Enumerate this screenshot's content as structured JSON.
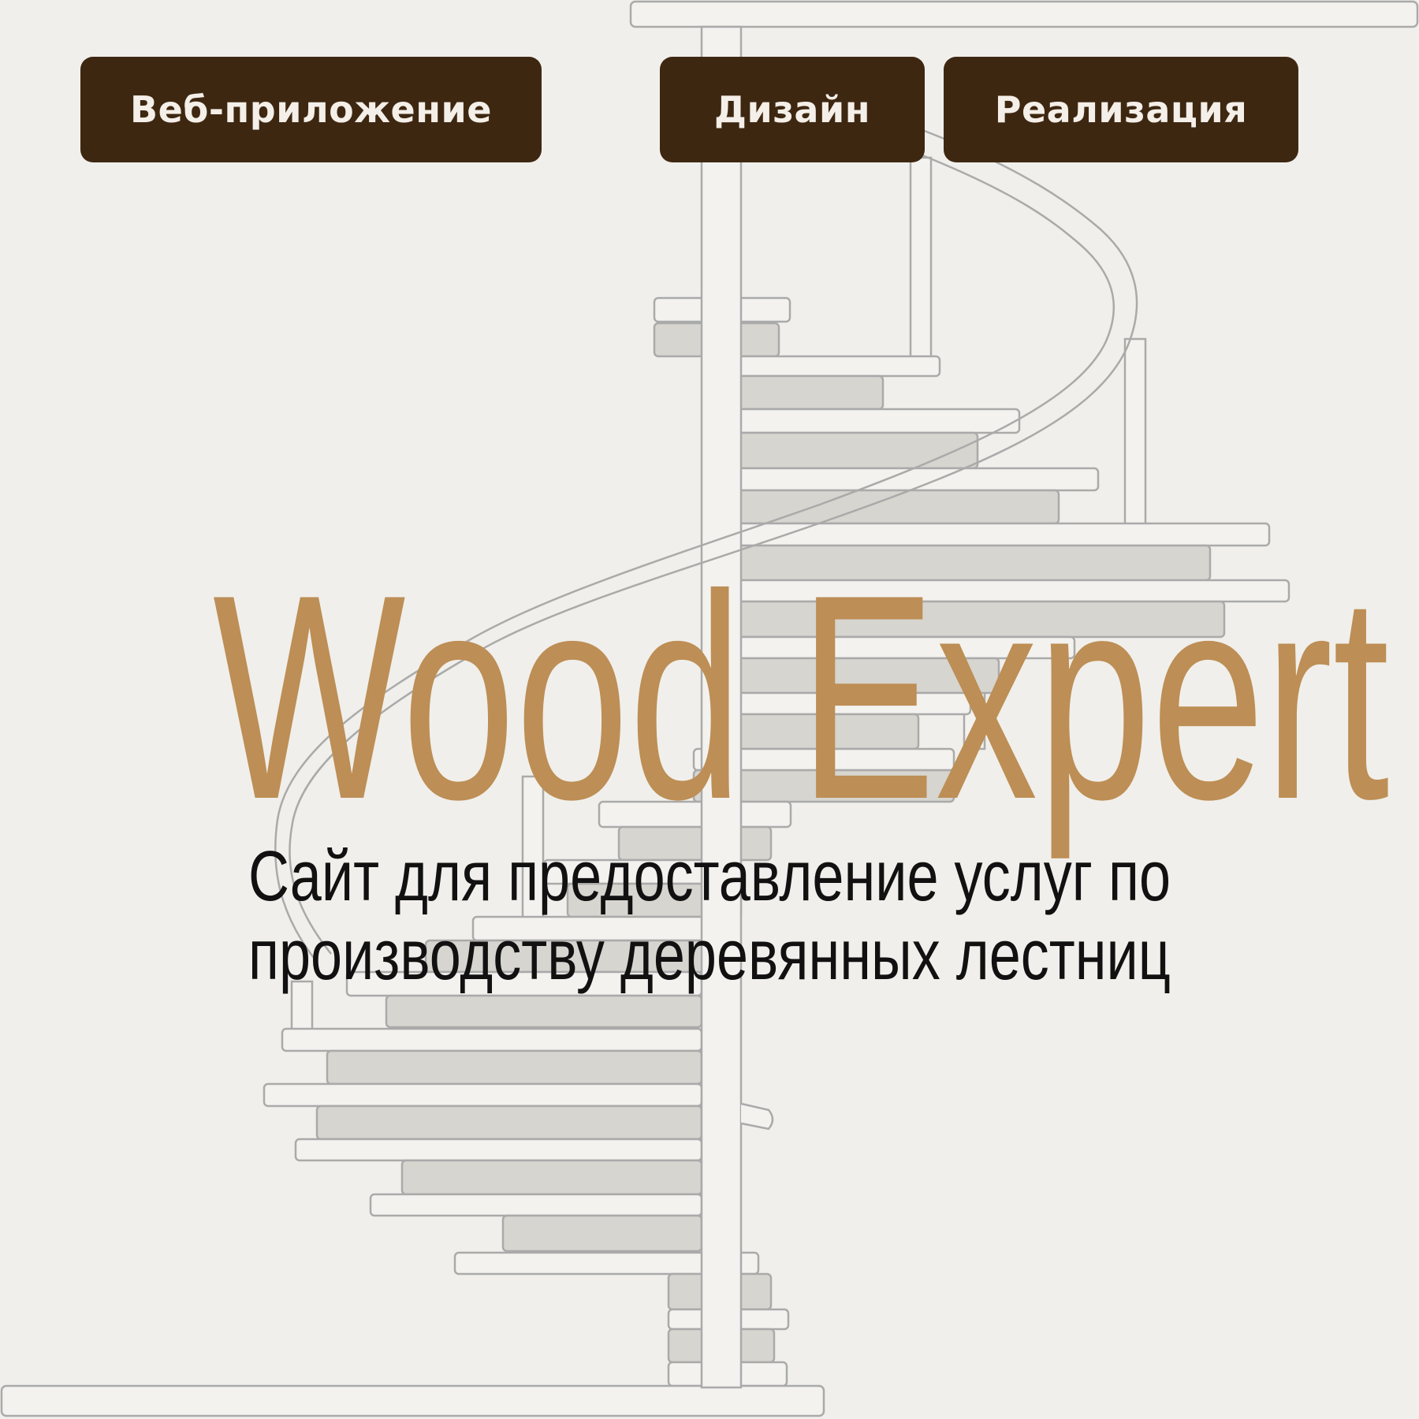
{
  "tags": {
    "web_app": "Веб-приложение",
    "design": "Дизайн",
    "implementation": "Реализация"
  },
  "hero": {
    "title": "Wood Expert",
    "subtitle_line1": "Сайт для предоставление услуг по",
    "subtitle_line2": "производству деревянных лестниц"
  },
  "colors": {
    "background": "#f0efeb",
    "tag_bg": "#3e2711",
    "tag_text": "#f4efe8",
    "title": "#bd8e55",
    "stair_stroke": "#aaaaaa",
    "stair_light": "#f3f2ef",
    "stair_dark": "#d6d5cf"
  }
}
